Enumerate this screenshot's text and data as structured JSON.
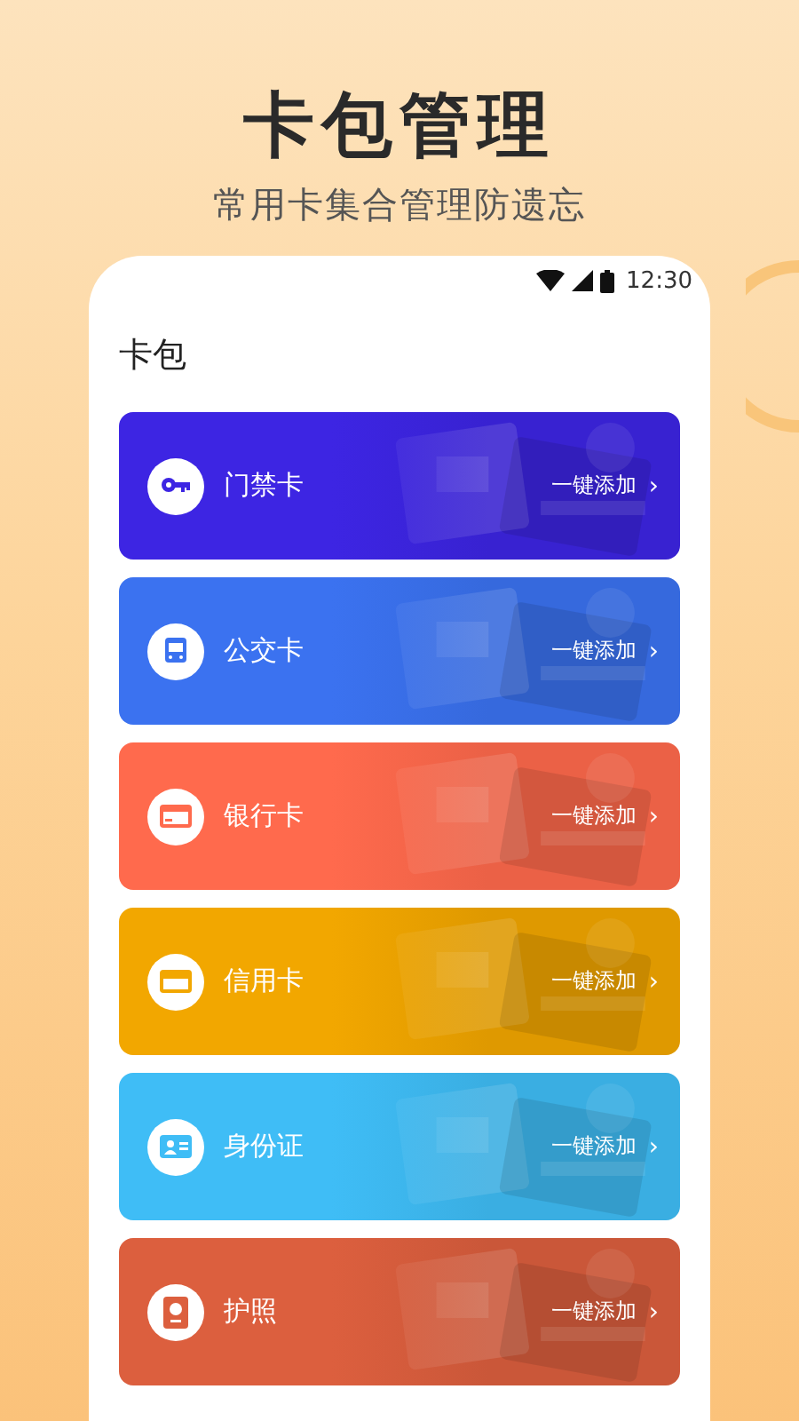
{
  "header": {
    "title": "卡包管理",
    "subtitle": "常用卡集合管理防遗忘"
  },
  "status_bar": {
    "time": "12:30"
  },
  "page_title": "卡包",
  "cards": [
    {
      "kind": "key",
      "label": "门禁卡",
      "action": "一键添加",
      "chevron": "›",
      "color": "#3d25e3"
    },
    {
      "kind": "bus",
      "label": "公交卡",
      "action": "一键添加",
      "chevron": "›",
      "color": "#3b72f0"
    },
    {
      "kind": "bank",
      "label": "银行卡",
      "action": "一键添加",
      "chevron": "›",
      "color": "#ff6a4d"
    },
    {
      "kind": "credit",
      "label": "信用卡",
      "action": "一键添加",
      "chevron": "›",
      "color": "#f2a700"
    },
    {
      "kind": "id",
      "label": "身份证",
      "action": "一键添加",
      "chevron": "›",
      "color": "#3fbdf6"
    },
    {
      "kind": "passport",
      "label": "护照",
      "action": "一键添加",
      "chevron": "›",
      "color": "#dc5f3e"
    }
  ]
}
